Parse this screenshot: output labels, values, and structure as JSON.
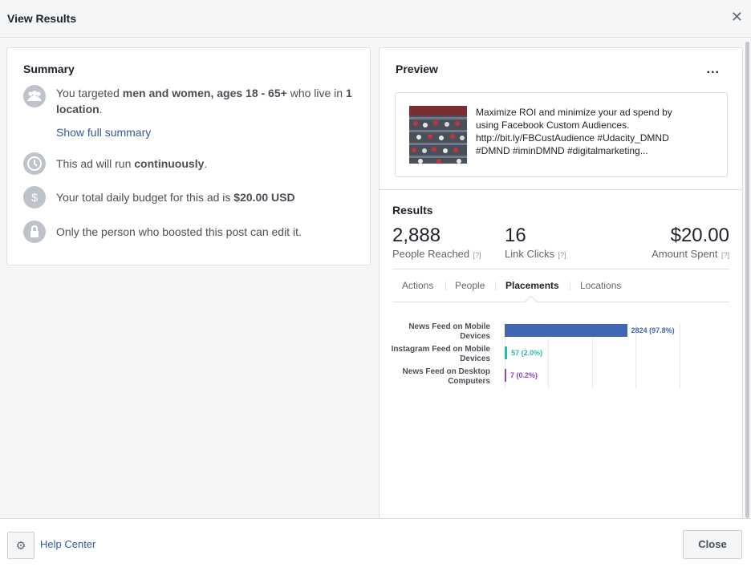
{
  "header": {
    "title": "View Results",
    "close_glyph": "✕"
  },
  "summary": {
    "title": "Summary",
    "targeting": {
      "prefix": "You targeted ",
      "audience": "men and women, ages 18 - 65+",
      "mid": " who live in ",
      "locations": "1 location",
      "suffix": "."
    },
    "show_full_summary": "Show full summary",
    "schedule": {
      "prefix": "This ad will run ",
      "value": "continuously",
      "suffix": "."
    },
    "budget": {
      "prefix": "Your total daily budget for this ad is ",
      "value": "$20.00 USD"
    },
    "permission": "Only the person who boosted this post can edit it."
  },
  "preview": {
    "title": "Preview",
    "more_glyph": "...",
    "post_text": "Maximize ROI and minimize your ad spend by using Facebook Custom Audiences. http://bit.ly/FBCustAudience #Udacity_DMND #DMND #iminDMND #digitalmarketing..."
  },
  "results": {
    "title": "Results",
    "metrics": [
      {
        "value": "2,888",
        "label": "People Reached",
        "help": "[?]"
      },
      {
        "value": "16",
        "label": "Link Clicks",
        "help": "[?]"
      },
      {
        "value": "$20.00",
        "label": "Amount Spent",
        "help": "[?]"
      }
    ],
    "tabs": [
      "Actions",
      "People",
      "Placements",
      "Locations"
    ],
    "active_tab": "Placements"
  },
  "chart_data": {
    "type": "bar",
    "orientation": "horizontal",
    "categories": [
      "News Feed on Mobile Devices",
      "Instagram Feed on Mobile Devices",
      "News Feed on Desktop Computers"
    ],
    "values": [
      2824,
      57,
      7
    ],
    "value_labels": [
      "2824 (97.8%)",
      "57 (2.0%)",
      "7 (0.2%)"
    ],
    "colors": [
      "#4267b2",
      "#2abba7",
      "#8c44c4"
    ],
    "grid": true
  },
  "footer": {
    "gear_glyph": "⚙",
    "help_center": "Help Center",
    "close": "Close"
  }
}
